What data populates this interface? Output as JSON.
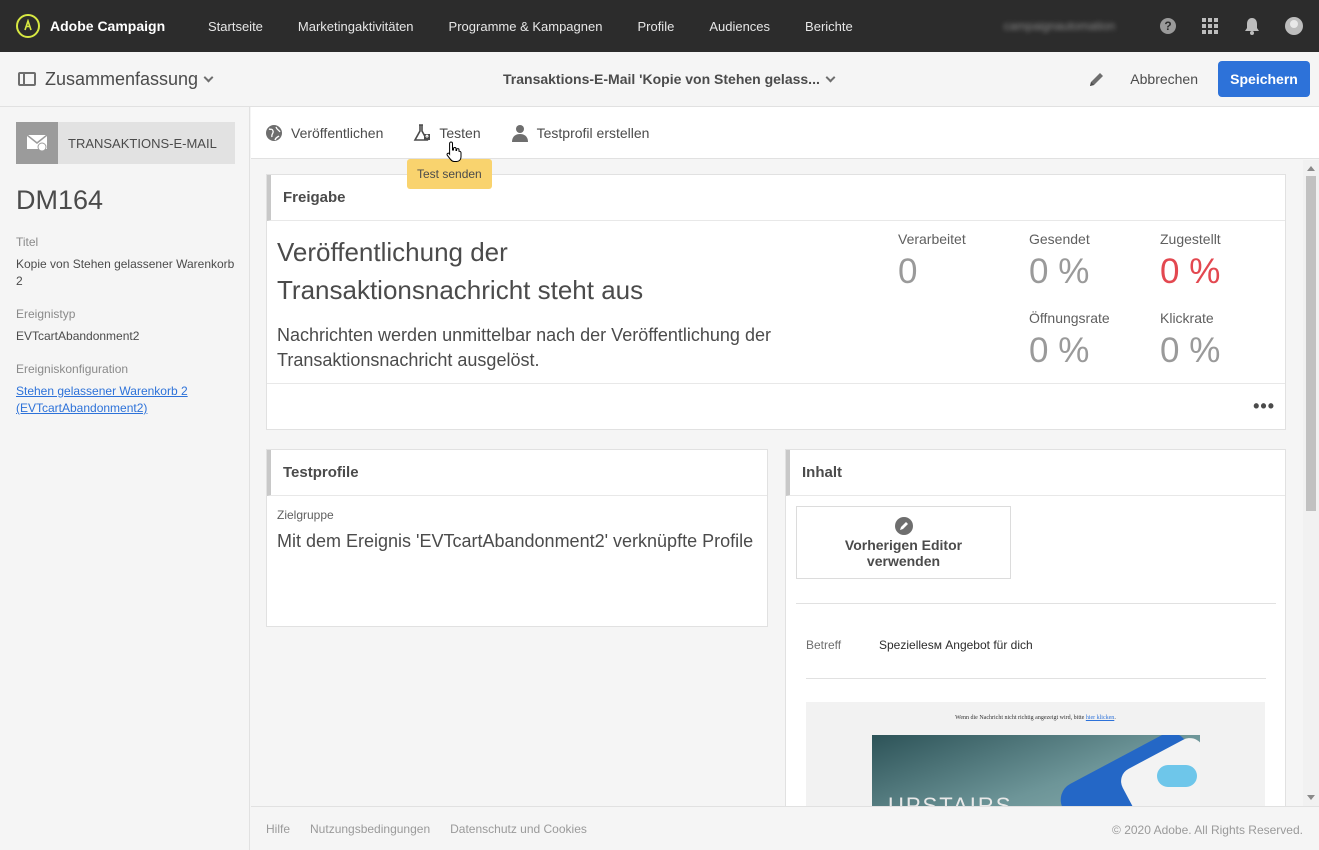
{
  "app": {
    "name": "Adobe Campaign"
  },
  "topnav": {
    "items": [
      "Startseite",
      "Marketingaktivitäten",
      "Programme & Kampagnen",
      "Profile",
      "Audiences",
      "Berichte"
    ],
    "user": "campaignautomation",
    "help_glyph": "?"
  },
  "subheader": {
    "summary_label": "Zusammenfassung",
    "document_title": "Transaktions-E-Mail 'Kopie von Stehen gelass...",
    "cancel_label": "Abbrechen",
    "save_label": "Speichern"
  },
  "left": {
    "type_label": "TRANSAKTIONS-E-MAIL",
    "id": "DM164",
    "title_label": "Titel",
    "title_value": "Kopie von Stehen gelassener Warenkorb 2",
    "event_type_label": "Ereignistyp",
    "event_type_value": "EVTcartAbandonment2",
    "event_config_label": "Ereigniskonfiguration",
    "event_config_value": "Stehen gelassener Warenkorb 2 (EVTcartAbandonment2)"
  },
  "toolbar": {
    "publish_label": "Veröffentlichen",
    "test_label": "Testen",
    "create_profile_label": "Testprofil erstellen",
    "tooltip": "Test senden"
  },
  "release": {
    "header": "Freigabe",
    "title": "Veröffentlichung der Transaktionsnachricht steht aus",
    "description": "Nachrichten werden unmittelbar nach der Veröffentlichung der Transaktionsnachricht ausgelöst.",
    "kpis": {
      "processed_label": "Verarbeitet",
      "processed_value": "0",
      "sent_label": "Gesendet",
      "sent_value": "0 %",
      "delivered_label": "Zugestellt",
      "delivered_value": "0 %",
      "open_label": "Öffnungsrate",
      "open_value": "0 %",
      "click_label": "Klickrate",
      "click_value": "0 %"
    },
    "more": "•••"
  },
  "test_profiles": {
    "header": "Testprofile",
    "target_label": "Zielgruppe",
    "target_value": "Mit dem Ereignis 'EVTcartAbandonment2' verknüpfte Profile"
  },
  "content": {
    "header": "Inhalt",
    "legacy_editor_label": "Vorherigen Editor verwenden",
    "subject_label": "Betreff",
    "subject_value": "Speziellesм Angebot für dich",
    "preview_note_prefix": "Wenn die Nachricht nicht richtig angezeigt wird, bitte",
    "preview_note_link": "hier klicken",
    "preview_hero_text": "UPSTAIRS"
  },
  "footer": {
    "links": [
      "Hilfe",
      "Nutzungsbedingungen",
      "Datenschutz und Cookies"
    ],
    "copyright": "© 2020 Adobe. All Rights Reserved."
  },
  "colors": {
    "nav_bg": "#2c2c2c",
    "primary": "#2d72d9",
    "negative": "#e34850",
    "tooltip": "#f9d36e"
  },
  "icons": [
    "adobe-campaign-logo-icon",
    "help-icon",
    "apps-grid-icon",
    "bell-icon",
    "user-avatar-icon",
    "panel-icon",
    "chevron-down-icon",
    "pencil-icon",
    "envelope-icon",
    "globe-icon",
    "flask-icon",
    "person-icon",
    "more-icon"
  ]
}
